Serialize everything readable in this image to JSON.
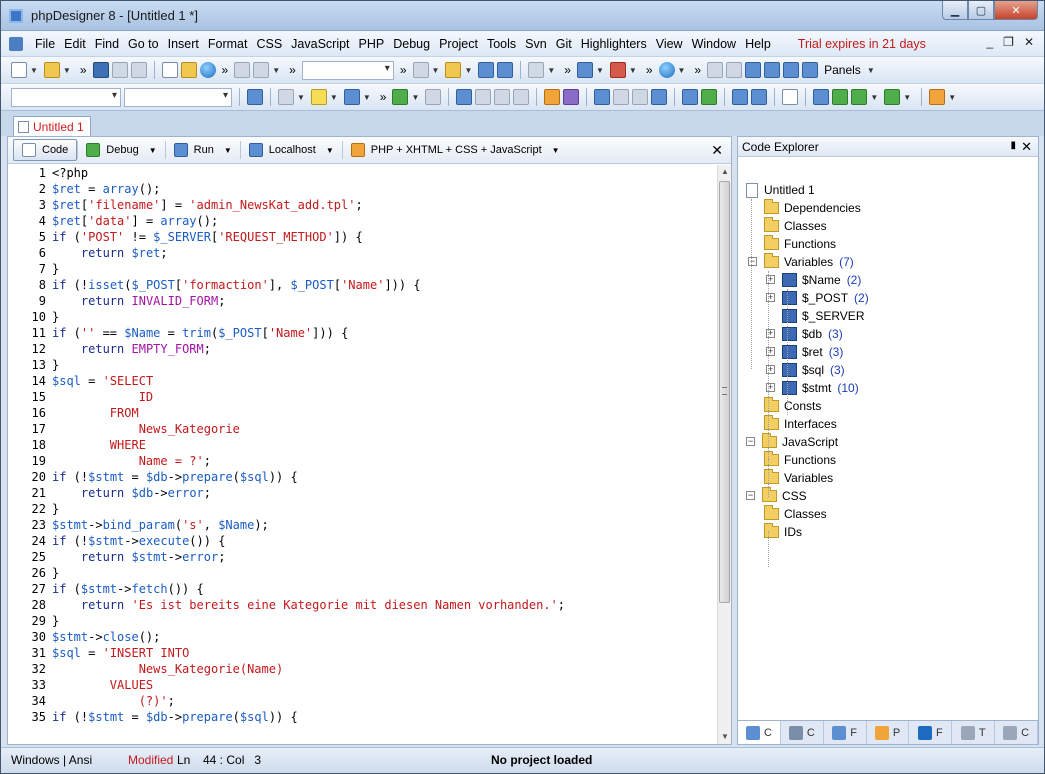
{
  "window": {
    "title": "phpDesigner 8 - [Untitled 1 *]",
    "controls": {
      "minimize": "▁",
      "maximize": "▢",
      "close": "✕"
    }
  },
  "menubar": {
    "items": [
      "File",
      "Edit",
      "Find",
      "Go to",
      "Insert",
      "Format",
      "CSS",
      "JavaScript",
      "PHP",
      "Debug",
      "Project",
      "Tools",
      "Svn",
      "Git",
      "Highlighters",
      "View",
      "Window",
      "Help"
    ],
    "trial_notice": "Trial expires in 21 days",
    "mdi_controls": {
      "minimize": "_",
      "restore": "❐",
      "close": "✕"
    }
  },
  "toolbar": {
    "panels_label": "Panels",
    "chevron": "»"
  },
  "document_tabs": [
    {
      "label": "Untitled 1"
    }
  ],
  "editor_toolbar": {
    "buttons": [
      {
        "label": "Code",
        "active": true
      },
      {
        "label": "Debug"
      },
      {
        "label": "Run"
      },
      {
        "label": "Localhost"
      },
      {
        "label": "PHP + XHTML + CSS + JavaScript"
      }
    ],
    "close": "✕"
  },
  "code_lines": [
    [
      [
        "t",
        "<?php"
      ]
    ],
    [
      [
        "v",
        "$ret"
      ],
      [
        "p",
        " = "
      ],
      [
        "f",
        "array"
      ],
      [
        "p",
        "();"
      ]
    ],
    [
      [
        "v",
        "$ret"
      ],
      [
        "p",
        "["
      ],
      [
        "s",
        "'filename'"
      ],
      [
        "p",
        "] = "
      ],
      [
        "s",
        "'admin_NewsKat_add.tpl'"
      ],
      [
        "p",
        ";"
      ]
    ],
    [
      [
        "v",
        "$ret"
      ],
      [
        "p",
        "["
      ],
      [
        "s",
        "'data'"
      ],
      [
        "p",
        "] = "
      ],
      [
        "f",
        "array"
      ],
      [
        "p",
        "();"
      ]
    ],
    [
      [
        "k",
        "if"
      ],
      [
        "p",
        " ("
      ],
      [
        "s",
        "'POST'"
      ],
      [
        "p",
        " != "
      ],
      [
        "v",
        "$_SERVER"
      ],
      [
        "p",
        "["
      ],
      [
        "s",
        "'REQUEST_METHOD'"
      ],
      [
        "p",
        "]) {"
      ]
    ],
    [
      [
        "p",
        "    "
      ],
      [
        "k",
        "return"
      ],
      [
        "p",
        " "
      ],
      [
        "v",
        "$ret"
      ],
      [
        "p",
        ";"
      ]
    ],
    [
      [
        "p",
        "}"
      ]
    ],
    [
      [
        "k",
        "if"
      ],
      [
        "p",
        " (!"
      ],
      [
        "f",
        "isset"
      ],
      [
        "p",
        "("
      ],
      [
        "v",
        "$_POST"
      ],
      [
        "p",
        "["
      ],
      [
        "s",
        "'formaction'"
      ],
      [
        "p",
        "], "
      ],
      [
        "v",
        "$_POST"
      ],
      [
        "p",
        "["
      ],
      [
        "s",
        "'Name'"
      ],
      [
        "p",
        "])) {"
      ]
    ],
    [
      [
        "p",
        "    "
      ],
      [
        "k",
        "return"
      ],
      [
        "p",
        " "
      ],
      [
        "c",
        "INVALID_FORM"
      ],
      [
        "p",
        ";"
      ]
    ],
    [
      [
        "p",
        "}"
      ]
    ],
    [
      [
        "k",
        "if"
      ],
      [
        "p",
        " ("
      ],
      [
        "s",
        "''"
      ],
      [
        "p",
        " == "
      ],
      [
        "v",
        "$Name"
      ],
      [
        "p",
        " = "
      ],
      [
        "f",
        "trim"
      ],
      [
        "p",
        "("
      ],
      [
        "v",
        "$_POST"
      ],
      [
        "p",
        "["
      ],
      [
        "s",
        "'Name'"
      ],
      [
        "p",
        "])) {"
      ]
    ],
    [
      [
        "p",
        "    "
      ],
      [
        "k",
        "return"
      ],
      [
        "p",
        " "
      ],
      [
        "c",
        "EMPTY_FORM"
      ],
      [
        "p",
        ";"
      ]
    ],
    [
      [
        "p",
        "}"
      ]
    ],
    [
      [
        "v",
        "$sql"
      ],
      [
        "p",
        " = "
      ],
      [
        "s",
        "'SELECT"
      ]
    ],
    [
      [
        "s",
        "            ID"
      ]
    ],
    [
      [
        "s",
        "        FROM"
      ]
    ],
    [
      [
        "s",
        "            News_Kategorie"
      ]
    ],
    [
      [
        "s",
        "        WHERE"
      ]
    ],
    [
      [
        "s",
        "            Name = ?'"
      ],
      [
        "p",
        ";"
      ]
    ],
    [
      [
        "k",
        "if"
      ],
      [
        "p",
        " (!"
      ],
      [
        "v",
        "$stmt"
      ],
      [
        "p",
        " = "
      ],
      [
        "v",
        "$db"
      ],
      [
        "p",
        "->"
      ],
      [
        "f",
        "prepare"
      ],
      [
        "p",
        "("
      ],
      [
        "v",
        "$sql"
      ],
      [
        "p",
        ")) {"
      ]
    ],
    [
      [
        "p",
        "    "
      ],
      [
        "k",
        "return"
      ],
      [
        "p",
        " "
      ],
      [
        "v",
        "$db"
      ],
      [
        "p",
        "->"
      ],
      [
        "f",
        "error"
      ],
      [
        "p",
        ";"
      ]
    ],
    [
      [
        "p",
        "}"
      ]
    ],
    [
      [
        "v",
        "$stmt"
      ],
      [
        "p",
        "->"
      ],
      [
        "f",
        "bind_param"
      ],
      [
        "p",
        "("
      ],
      [
        "s",
        "'s'"
      ],
      [
        "p",
        ", "
      ],
      [
        "v",
        "$Name"
      ],
      [
        "p",
        ");"
      ]
    ],
    [
      [
        "k",
        "if"
      ],
      [
        "p",
        " (!"
      ],
      [
        "v",
        "$stmt"
      ],
      [
        "p",
        "->"
      ],
      [
        "f",
        "execute"
      ],
      [
        "p",
        "()) {"
      ]
    ],
    [
      [
        "p",
        "    "
      ],
      [
        "k",
        "return"
      ],
      [
        "p",
        " "
      ],
      [
        "v",
        "$stmt"
      ],
      [
        "p",
        "->"
      ],
      [
        "f",
        "error"
      ],
      [
        "p",
        ";"
      ]
    ],
    [
      [
        "p",
        "}"
      ]
    ],
    [
      [
        "k",
        "if"
      ],
      [
        "p",
        " ("
      ],
      [
        "v",
        "$stmt"
      ],
      [
        "p",
        "->"
      ],
      [
        "f",
        "fetch"
      ],
      [
        "p",
        "()) {"
      ]
    ],
    [
      [
        "p",
        "    "
      ],
      [
        "k",
        "return"
      ],
      [
        "p",
        " "
      ],
      [
        "s",
        "'Es ist bereits eine Kategorie mit diesen Namen vorhanden.'"
      ],
      [
        "p",
        ";"
      ]
    ],
    [
      [
        "p",
        "}"
      ]
    ],
    [
      [
        "v",
        "$stmt"
      ],
      [
        "p",
        "->"
      ],
      [
        "f",
        "close"
      ],
      [
        "p",
        "();"
      ]
    ],
    [
      [
        "v",
        "$sql"
      ],
      [
        "p",
        " = "
      ],
      [
        "s",
        "'INSERT INTO"
      ]
    ],
    [
      [
        "s",
        "            News_Kategorie(Name)"
      ]
    ],
    [
      [
        "s",
        "        VALUES"
      ]
    ],
    [
      [
        "s",
        "            (?)'"
      ],
      [
        "p",
        ";"
      ]
    ],
    [
      [
        "k",
        "if"
      ],
      [
        "p",
        " (!"
      ],
      [
        "v",
        "$stmt"
      ],
      [
        "p",
        " = "
      ],
      [
        "v",
        "$db"
      ],
      [
        "p",
        "->"
      ],
      [
        "f",
        "prepare"
      ],
      [
        "p",
        "("
      ],
      [
        "v",
        "$sql"
      ],
      [
        "p",
        ")) {"
      ]
    ]
  ],
  "code_explorer": {
    "title": "Code Explorer",
    "pin": "📌",
    "close": "✕",
    "tree": [
      {
        "label": "Untitled 1",
        "icon": "doc",
        "level": 0
      },
      {
        "label": "Dependencies",
        "icon": "folder",
        "level": 1
      },
      {
        "label": "Classes",
        "icon": "folder",
        "level": 1
      },
      {
        "label": "Functions",
        "icon": "folder",
        "level": 1
      },
      {
        "label": "Variables",
        "icon": "folder",
        "level": 1,
        "count": "(7)",
        "expanded": true
      },
      {
        "label": "$Name",
        "icon": "var",
        "level": 2,
        "count": "(2)",
        "expandable": true
      },
      {
        "label": "$_POST",
        "icon": "var",
        "level": 2,
        "count": "(2)",
        "expandable": true
      },
      {
        "label": "$_SERVER",
        "icon": "var",
        "level": 2
      },
      {
        "label": "$db",
        "icon": "var",
        "level": 2,
        "count": "(3)",
        "expandable": true
      },
      {
        "label": "$ret",
        "icon": "var",
        "level": 2,
        "count": "(3)",
        "expandable": true
      },
      {
        "label": "$sql",
        "icon": "var",
        "level": 2,
        "count": "(3)",
        "expandable": true
      },
      {
        "label": "$stmt",
        "icon": "var",
        "level": 2,
        "count": "(10)",
        "expandable": true
      },
      {
        "label": "Consts",
        "icon": "folder",
        "level": 1
      },
      {
        "label": "Interfaces",
        "icon": "folder",
        "level": 1
      },
      {
        "label": "JavaScript",
        "icon": "folder",
        "level": 0,
        "expanded": true
      },
      {
        "label": "Functions",
        "icon": "folder",
        "level": 1
      },
      {
        "label": "Variables",
        "icon": "folder",
        "level": 1
      },
      {
        "label": "CSS",
        "icon": "folder",
        "level": 0,
        "expanded": true
      },
      {
        "label": "Classes",
        "icon": "folder",
        "level": 1
      },
      {
        "label": "IDs",
        "icon": "folder",
        "level": 1
      }
    ],
    "bottom_tabs": [
      "C",
      "C",
      "F",
      "P",
      "F",
      "T",
      "C"
    ]
  },
  "statusbar": {
    "encoding": "Windows | Ansi",
    "modified": "Modified",
    "ln_label": "Ln",
    "position": "44 : Col   3",
    "project": "No project loaded"
  },
  "colors": {
    "variable": "#1a5cc4",
    "string": "#c2191b",
    "keyword": "#1a2e8a",
    "constant": "#a313a3",
    "trial": "#c41a1a",
    "count": "#1a3eb8"
  }
}
